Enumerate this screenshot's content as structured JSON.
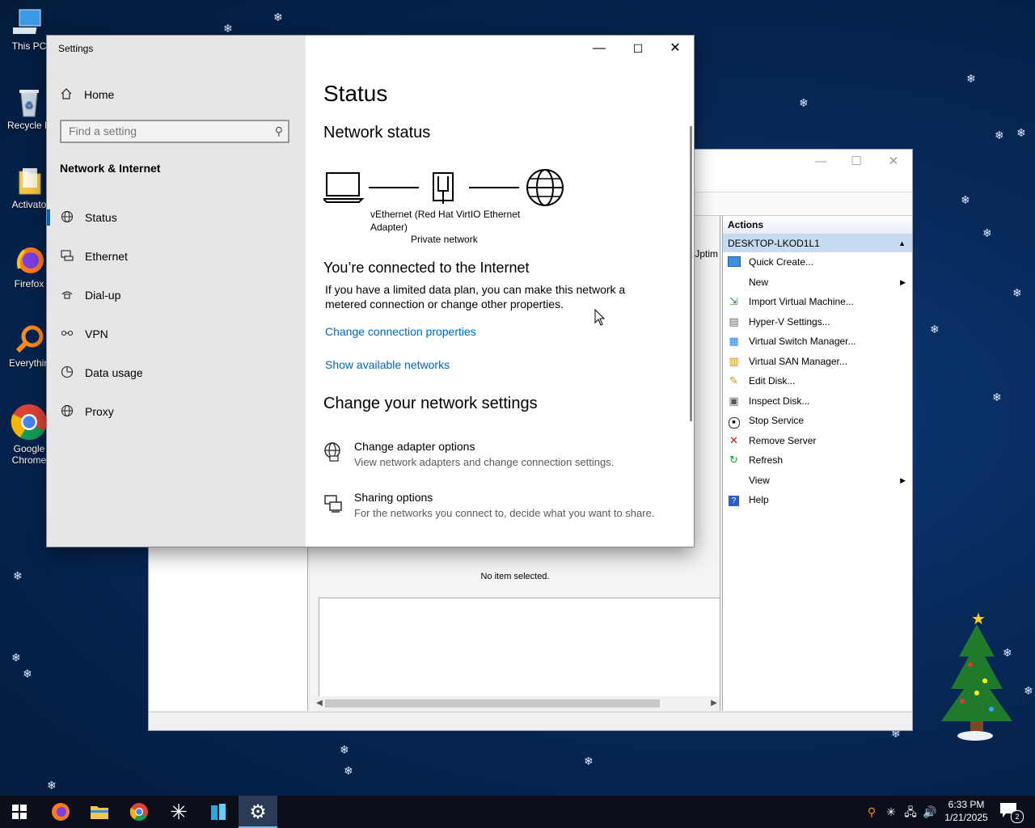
{
  "desktop": {
    "icons": [
      {
        "label": "This PC",
        "icon": "computer-icon"
      },
      {
        "label": "Recycle B",
        "icon": "recycle-bin-icon"
      },
      {
        "label": "Activato",
        "icon": "folder-icon"
      },
      {
        "label": "Firefox",
        "icon": "firefox-icon"
      },
      {
        "label": "Everythin",
        "icon": "search-app-icon"
      },
      {
        "label": "Google\nChrome",
        "icon": "chrome-icon"
      }
    ]
  },
  "hyperv": {
    "uptime_label": "Jptim",
    "no_item": "No item selected.",
    "actions": {
      "header": "Actions",
      "server": "DESKTOP-LKOD1L1",
      "items": [
        {
          "label": "Quick Create...",
          "icon": "quick-create-icon",
          "submenu": false
        },
        {
          "label": "New",
          "icon": "",
          "submenu": true
        },
        {
          "label": "Import Virtual Machine...",
          "icon": "import-icon",
          "submenu": false
        },
        {
          "label": "Hyper-V Settings...",
          "icon": "settings-doc-icon",
          "submenu": false
        },
        {
          "label": "Virtual Switch Manager...",
          "icon": "switch-icon",
          "submenu": false
        },
        {
          "label": "Virtual SAN Manager...",
          "icon": "san-icon",
          "submenu": false
        },
        {
          "label": "Edit Disk...",
          "icon": "edit-disk-icon",
          "submenu": false
        },
        {
          "label": "Inspect Disk...",
          "icon": "inspect-disk-icon",
          "submenu": false
        },
        {
          "label": "Stop Service",
          "icon": "stop-icon",
          "submenu": false
        },
        {
          "label": "Remove Server",
          "icon": "remove-icon",
          "submenu": false
        },
        {
          "label": "Refresh",
          "icon": "refresh-icon",
          "submenu": false
        },
        {
          "label": "View",
          "icon": "",
          "submenu": true
        },
        {
          "label": "Help",
          "icon": "help-icon",
          "submenu": false
        }
      ]
    }
  },
  "settings": {
    "app_title": "Settings",
    "home_label": "Home",
    "search_placeholder": "Find a setting",
    "section_title": "Network & Internet",
    "nav_items": [
      {
        "label": "Status",
        "icon": "globe-icon",
        "selected": true
      },
      {
        "label": "Ethernet",
        "icon": "ethernet-icon",
        "selected": false
      },
      {
        "label": "Dial-up",
        "icon": "dialup-icon",
        "selected": false
      },
      {
        "label": "VPN",
        "icon": "vpn-icon",
        "selected": false
      },
      {
        "label": "Data usage",
        "icon": "data-usage-icon",
        "selected": false
      },
      {
        "label": "Proxy",
        "icon": "proxy-globe-icon",
        "selected": false
      }
    ],
    "main": {
      "title": "Status",
      "network_status_heading": "Network status",
      "adapter_name": "vEthernet (Red Hat VirtIO Ethernet\nAdapter)",
      "network_type": "Private network",
      "connected_heading": "You’re connected to the Internet",
      "connected_body": "If you have a limited data plan, you can make this network a metered connection or change other properties.",
      "change_props_link": "Change connection properties",
      "show_networks_link": "Show available networks",
      "change_settings_heading": "Change your network settings",
      "options": [
        {
          "title": "Change adapter options",
          "desc": "View network adapters and change connection settings.",
          "icon": "adapter-icon"
        },
        {
          "title": "Sharing options",
          "desc": "For the networks you connect to, decide what you want to share.",
          "icon": "sharing-icon"
        }
      ]
    }
  },
  "taskbar": {
    "apps": [
      "start-icon",
      "firefox-icon",
      "file-explorer-icon",
      "chrome-icon",
      "everything-icon",
      "hyperv-icon",
      "settings-gear-icon"
    ],
    "time": "6:33 PM",
    "date": "1/21/2025",
    "notification_count": "2"
  },
  "colors": {
    "accent": "#0067b8",
    "nav_bg": "#e6e6e6",
    "taskbar": "#0b0f1a"
  }
}
